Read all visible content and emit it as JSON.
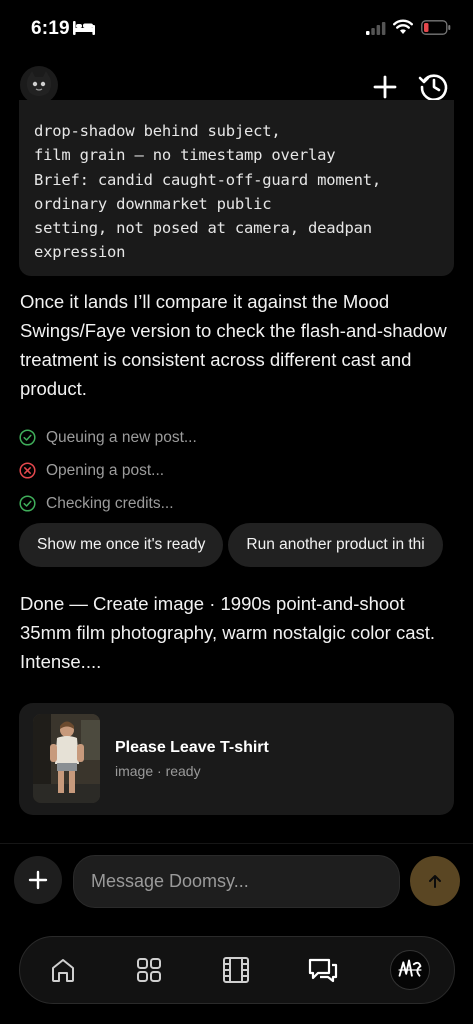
{
  "status_bar": {
    "time": "6:19"
  },
  "code_block": {
    "lines": [
      "drop-shadow behind subject,",
      "film grain — no timestamp overlay",
      "Brief: candid caught-off-guard moment,",
      "ordinary downmarket public",
      "setting, not posed at camera, deadpan",
      "expression"
    ]
  },
  "messages": {
    "para1": "Once it lands I’ll compare it against the Mood Swings/Faye version to check the flash-and-shadow treatment is consistent across different cast and product.",
    "para2": "Done — Create image · 1990s point-and-shoot 35mm film photography, warm nostalgic color cast. Intense...."
  },
  "status_items": [
    {
      "label": "Queuing a new post...",
      "state": "success",
      "icon": "check-circle-icon",
      "color": "#3fae5a"
    },
    {
      "label": "Opening a post...",
      "state": "error",
      "icon": "x-circle-icon",
      "color": "#e5484d"
    },
    {
      "label": "Checking credits...",
      "state": "success",
      "icon": "check-circle-icon",
      "color": "#3fae5a"
    }
  ],
  "chips": [
    {
      "label": "Show me once it's ready"
    },
    {
      "label": "Run another product in thi"
    }
  ],
  "result_card": {
    "title": "Please Leave T-shirt",
    "subtitle": "image · ready"
  },
  "composer": {
    "placeholder": "Message Doomsy..."
  },
  "tabbar": {
    "items": [
      {
        "icon": "home-icon"
      },
      {
        "icon": "grid-icon"
      },
      {
        "icon": "film-icon"
      },
      {
        "icon": "chat-icon",
        "active": true
      },
      {
        "icon": "profile-avatar"
      }
    ]
  },
  "colors": {
    "accent_send": "#5a4623",
    "success": "#3fae5a",
    "error": "#e5484d",
    "background": "#000000"
  }
}
